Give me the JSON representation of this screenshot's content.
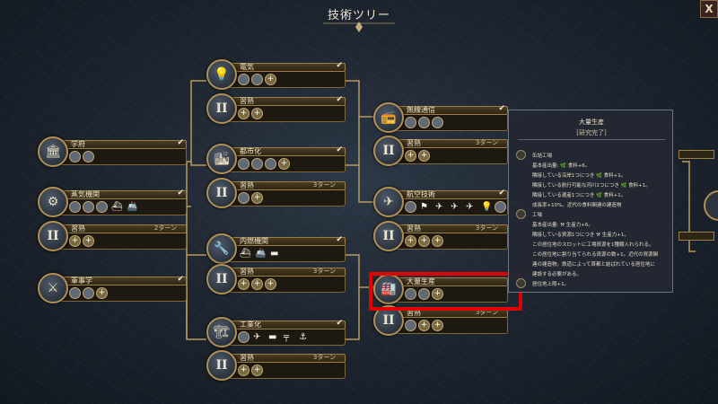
{
  "header": {
    "title": "技術ツリー",
    "close_label": "X"
  },
  "nodes": [
    {
      "id": "electricity",
      "label": "電気",
      "type": "tech",
      "done": true,
      "turns": "",
      "icon": "lightbulb-icon",
      "glyph": "💡",
      "items": [
        "sq",
        "sq",
        "plus"
      ]
    },
    {
      "id": "electricity-mastery",
      "label": "習熟",
      "type": "mastery",
      "done": true,
      "turns": "",
      "icon": "roman-two-icon",
      "glyph": "II",
      "items": [
        "plus",
        "plus"
      ]
    },
    {
      "id": "academy",
      "label": "学府",
      "type": "tech",
      "done": true,
      "turns": "",
      "icon": "academy-icon",
      "glyph": "🏛",
      "items": [
        "sq",
        "sq"
      ]
    },
    {
      "id": "urbanization",
      "label": "都市化",
      "type": "tech",
      "done": true,
      "turns": "",
      "icon": "city-icon",
      "glyph": "🏙",
      "items": [
        "sq",
        "sq",
        "sq",
        "plus"
      ]
    },
    {
      "id": "urbanization-mastery",
      "label": "習熟",
      "type": "mastery",
      "done": false,
      "turns": "3ターン",
      "icon": "roman-two-icon",
      "glyph": "II",
      "items": [
        "sq",
        "plus"
      ]
    },
    {
      "id": "radio",
      "label": "無線通信",
      "type": "tech",
      "done": true,
      "turns": "",
      "icon": "radio-icon",
      "glyph": "📻",
      "items": [
        "sq",
        "sq",
        "sq"
      ]
    },
    {
      "id": "radio-mastery",
      "label": "習熟",
      "type": "mastery",
      "done": false,
      "turns": "3ターン",
      "icon": "roman-two-icon",
      "glyph": "II",
      "items": [
        "plus",
        "plus"
      ]
    },
    {
      "id": "steam-engine",
      "label": "蒸気機関",
      "type": "tech",
      "done": true,
      "turns": "",
      "icon": "steam-engine-icon",
      "glyph": "⚙",
      "items": [
        "sq",
        "sq",
        "sq",
        "unit-ship",
        "unit-ship2"
      ]
    },
    {
      "id": "steam-mastery",
      "label": "習熟",
      "type": "mastery",
      "done": false,
      "turns": "2ターン",
      "icon": "roman-two-icon",
      "glyph": "II",
      "items": [
        "plus",
        "plus"
      ]
    },
    {
      "id": "combustion",
      "label": "内燃機関",
      "type": "tech",
      "done": true,
      "turns": "",
      "icon": "engine-icon",
      "glyph": "🔧",
      "items": [
        "unit-ship",
        "unit-ship2",
        "unit-tank"
      ]
    },
    {
      "id": "combustion-mastery",
      "label": "習熟",
      "type": "mastery",
      "done": false,
      "turns": "3ターン",
      "icon": "roman-two-icon",
      "glyph": "II",
      "items": [
        "plus",
        "plus",
        "plus"
      ]
    },
    {
      "id": "aviation",
      "label": "航空技術",
      "type": "tech",
      "done": true,
      "turns": "",
      "icon": "aviation-icon",
      "glyph": "✈",
      "items": [
        "sq",
        "unit-flag",
        "unit-plane",
        "unit-plane2",
        "unit-plane3",
        "bulb",
        "sq"
      ]
    },
    {
      "id": "aviation-mastery",
      "label": "習熟",
      "type": "mastery",
      "done": false,
      "turns": "3ターン",
      "icon": "roman-two-icon",
      "glyph": "II",
      "items": [
        "plus",
        "plus",
        "plus"
      ]
    },
    {
      "id": "military-science",
      "label": "軍事学",
      "type": "tech",
      "done": true,
      "turns": "",
      "icon": "military-icon",
      "glyph": "⚔",
      "items": [
        "sq",
        "sq",
        "plus"
      ]
    },
    {
      "id": "mass-production",
      "label": "大量生産",
      "type": "tech",
      "done": false,
      "turns": "",
      "icon": "factory-icon",
      "glyph": "🏭",
      "items": [
        "sq",
        "sq",
        "plus"
      ]
    },
    {
      "id": "mass-mastery",
      "label": "習熟",
      "type": "mastery",
      "done": false,
      "turns": "3ターン",
      "icon": "roman-two-icon",
      "glyph": "II",
      "items": [
        "sq",
        "plus",
        "plus"
      ]
    },
    {
      "id": "industrialization",
      "label": "工業化",
      "type": "tech",
      "done": true,
      "turns": "",
      "icon": "industry-icon",
      "glyph": "🏗",
      "items": [
        "sq",
        "unit-plane",
        "unit-tank",
        "unit-rifle",
        "unit-anchor"
      ]
    },
    {
      "id": "industrialization-mastery",
      "label": "習熟",
      "type": "mastery",
      "done": false,
      "turns": "3ターン",
      "icon": "roman-two-icon",
      "glyph": "II",
      "items": [
        "plus",
        "plus"
      ]
    }
  ],
  "tooltip": {
    "title": "大量生産",
    "status": "[研究完了]",
    "lines": [
      {
        "bullet": true,
        "text": "缶詰工場"
      },
      {
        "bullet": false,
        "text": "基本産出量: 🌿 食料+6。"
      },
      {
        "bullet": false,
        "text": "隣接している沿岸1つにつき 🌿 食料+1。"
      },
      {
        "bullet": false,
        "text": "隣接している航行可能な河川1つにつき 🌿 食料+1。"
      },
      {
        "bullet": false,
        "text": "隣接している遺産1つにつき 🌿 食料+1。"
      },
      {
        "bullet": false,
        "text": "成長率+10%。近代の食料関連の建造物"
      },
      {
        "bullet": true,
        "text": "工場"
      },
      {
        "bullet": false,
        "text": "基本産出量: ⚒ 生産力+6。"
      },
      {
        "bullet": false,
        "text": "隣接している資源1つにつき ⚒ 生産力+1。"
      },
      {
        "bullet": false,
        "text": "この居住地のスロットに工場資源を1種類入れられる。"
      },
      {
        "bullet": false,
        "text": "この居住地に割り当てられる資源の数+1。近代の資源関"
      },
      {
        "bullet": false,
        "text": "連の建造物。鉄道によって首都と結ばれている居住地に"
      },
      {
        "bullet": false,
        "text": "建設する必要がある。"
      },
      {
        "bullet": true,
        "text": "居住地上限+1。"
      }
    ]
  },
  "colors": {
    "gold": "#b08f55",
    "highlight": "#e00000",
    "bar": "#2e2614"
  }
}
